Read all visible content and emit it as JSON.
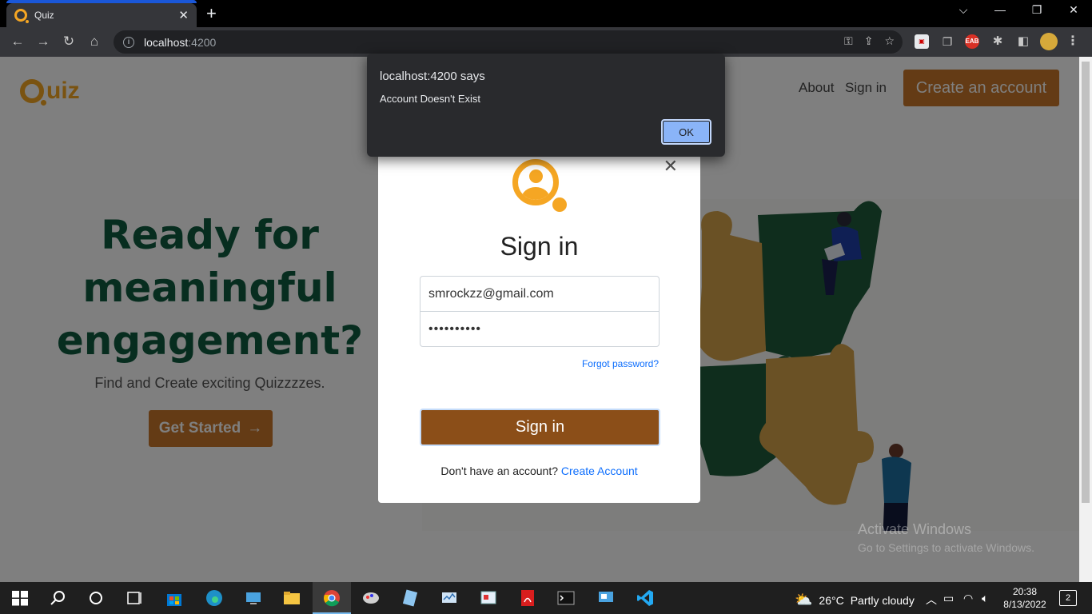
{
  "browser": {
    "tab_title": "Quiz",
    "tab_close": "✕",
    "new_tab": "+",
    "url_host": "localhost",
    "url_port": ":4200",
    "window_controls": [
      "⌵",
      "—",
      "❐",
      "✕"
    ]
  },
  "nav": {
    "logo_text": "uiz",
    "links": [
      "About",
      "Sign in"
    ],
    "cta": "Create an account"
  },
  "hero": {
    "title_lines": [
      "Ready for",
      "meaningful",
      "engagement?"
    ],
    "subtitle": "Find and Create exciting Quizzzzes.",
    "button": "Get Started",
    "button_arrow": "→"
  },
  "modal": {
    "close": "✕",
    "title": "Sign in",
    "email_value": "smrockzz@gmail.com",
    "password_value": "••••••••••",
    "forgot": "Forgot password?",
    "submit": "Sign in",
    "no_account": "Don't have an account?",
    "create_link": "Create Account"
  },
  "alert": {
    "title": "localhost:4200 says",
    "message": "Account Doesn't Exist",
    "ok": "OK"
  },
  "watermark": {
    "line1": "Activate Windows",
    "line2": "Go to Settings to activate Windows."
  },
  "taskbar": {
    "temperature": "26°C",
    "condition": "Partly cloudy",
    "time": "20:38",
    "date": "8/13/2022",
    "notifications": "2"
  },
  "colors": {
    "accent_orange": "#c8772a",
    "logo_yellow": "#f5a623",
    "hero_green": "#0f5b3f",
    "signin_brown": "#8b4e18",
    "link_blue": "#0d6efd"
  }
}
